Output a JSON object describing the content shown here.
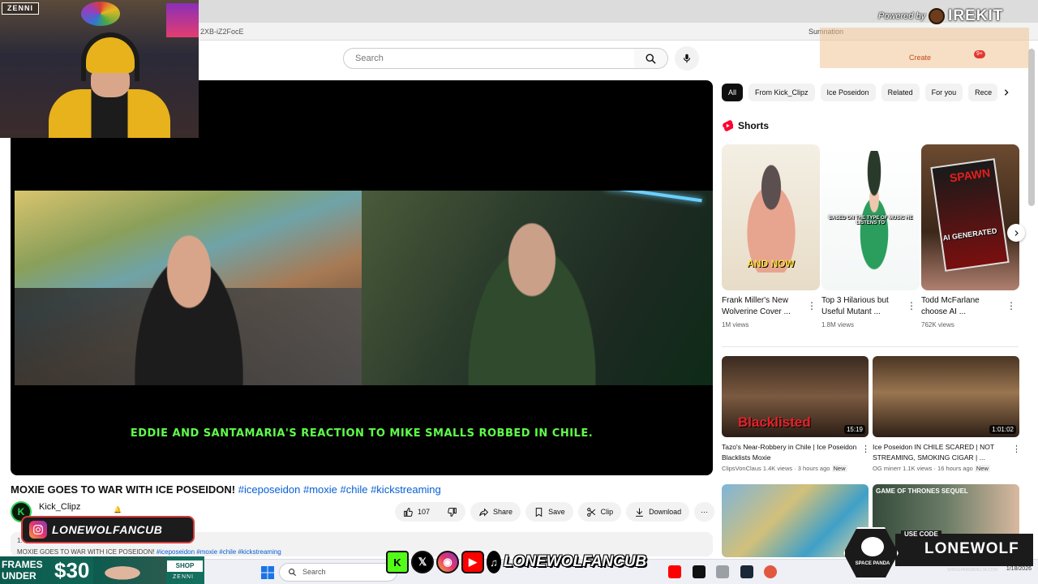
{
  "browser": {
    "url_fragment": "2XB-iZ2FocE",
    "right_text": "Sumnation"
  },
  "header": {
    "search_placeholder": "Search"
  },
  "player": {
    "caption": "EDDIE AND SANTAMARIA'S REACTION TO MIKE SMALLS ROBBED IN CHILE."
  },
  "video": {
    "title": "MOXIE GOES TO WAR WITH ICE POSEIDON!",
    "hashtags": "#iceposeidon #moxie #chile #kickstreaming",
    "channel_initial": "K",
    "channel_name": "Kick_Clipz",
    "like_count": "107",
    "share_label": "Share",
    "save_label": "Save",
    "clip_label": "Clip",
    "download_label": "Download",
    "more_label": "⋯",
    "desc_line1": "1.",
    "desc_title": "MOXIE GOES TO WAR WITH ICE POSEIDON!",
    "desc_tags": "#iceposeidon #moxie #chile #kickstreaming"
  },
  "chips": [
    "All",
    "From Kick_Clipz",
    "Ice Poseidon",
    "Related",
    "For you",
    "Rece"
  ],
  "shorts": {
    "heading": "Shorts",
    "items": [
      {
        "title": "Frank Miller's New Wolverine Cover ...",
        "views": "1M views",
        "overlay": "AND NOW"
      },
      {
        "title": "Top 3 Hilarious but Useful Mutant ...",
        "views": "1.8M views",
        "overlay": "BASED ON THE TYPE OF MUSIC HE LISTENS TO"
      },
      {
        "title": "Todd McFarlane choose AI ...",
        "views": "762K views",
        "overlay_title": "SPAWN",
        "overlay": "AI GENERATED"
      }
    ]
  },
  "recommended": [
    {
      "title": "Tazo's Near-Robbery in Chile | Ice Poseidon Blacklists Moxie",
      "channel": "ClipsVonClaus",
      "stats": "1.4K views · 3 hours ago",
      "badge": "New",
      "duration": "15:19",
      "overlay": "Blacklisted"
    },
    {
      "title": "Ice Poseidon IN CHILE SCARED | NOT STREAMING, SMOKING CIGAR | ...",
      "channel": "OG minerr",
      "stats": "1.1K views · 16 hours ago",
      "badge": "New",
      "duration": "1:01:02",
      "overlay": ""
    }
  ],
  "bottom_thumbs": [
    {
      "overlay": ""
    },
    {
      "overlay": "GAME OF THRONES SEQUEL"
    }
  ],
  "overlays": {
    "webcam_brand": "ZENNI",
    "powered_by": "Powered by",
    "powered_logo": "IREKIT",
    "create_label": "Create",
    "notif_count": "9+",
    "banner_handle": "LONEWOLFANCUB",
    "ad_line1": "FRAMES",
    "ad_line2": "UNDER",
    "ad_price": "$30",
    "ad_cta": "SHOP NOW",
    "ad_brand": "ZENNI",
    "social_handle": "LONEWOLFANCUB",
    "promo_use": "USE CODE",
    "promo_code": "LONEWOLF",
    "promo_logo": "SPACE PANDA",
    "promo_site": "SPACEPANDADELTA.COM"
  },
  "taskbar": {
    "search_label": "Search",
    "date": "1/18/2026"
  },
  "colors": {
    "caption_green": "#5fff4a",
    "link_blue": "#065fd4",
    "shorts_red": "#ff0033"
  }
}
